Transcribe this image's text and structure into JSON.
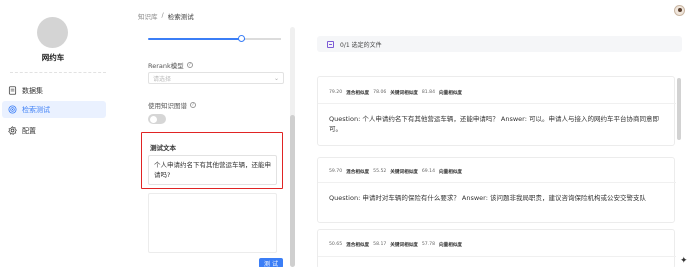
{
  "sidebar": {
    "kb_name": "网约车",
    "items": [
      {
        "label": "数据集",
        "icon": "file-icon",
        "active": false
      },
      {
        "label": "检索测试",
        "icon": "target-icon",
        "active": true
      },
      {
        "label": "配置",
        "icon": "gear-icon",
        "active": false
      }
    ]
  },
  "breadcrumb": {
    "parent": "知识库",
    "separator": "/",
    "current": "检索测试"
  },
  "settings": {
    "rerank_label": "Rerank模型",
    "rerank_placeholder": "请选择",
    "kg_label": "使用知识图谱",
    "kg_enabled": false,
    "test_title": "测试文本",
    "test_text": "个人申请约名下有其他营运车辆，还能申请吗?",
    "test_button": "测 试"
  },
  "results": {
    "file_bar": "0/1 选定的文件",
    "cards": [
      {
        "hybrid_score": "79.20",
        "hybrid_label": "混合相似度",
        "keyword_score": "78.06",
        "keyword_label": "关键词相似度",
        "vector_score": "81.84",
        "vector_label": "向量相似度",
        "text": "Question: 个人申请约名下有其他营运车辆，还能申请吗？ Answer: 可以。申请人与接入的网约车平台协商同意即可。"
      },
      {
        "hybrid_score": "59.70",
        "hybrid_label": "混合相似度",
        "keyword_score": "55.52",
        "keyword_label": "关键词相似度",
        "vector_score": "69.14",
        "vector_label": "向量相似度",
        "text": "Question: 申请时对车辆的保险有什么要求？ Answer: 该问题非我局职责，建议咨询保险机构或公安交警支队"
      },
      {
        "hybrid_score": "50.65",
        "hybrid_label": "混合相似度",
        "keyword_score": "58.17",
        "keyword_label": "关键词相似度",
        "vector_score": "57.78",
        "vector_label": "向量相似度",
        "text": ""
      }
    ]
  },
  "colors": {
    "accent": "#3b7ef6",
    "highlight_border": "#e02424",
    "checkbox": "#7d5bd6"
  }
}
